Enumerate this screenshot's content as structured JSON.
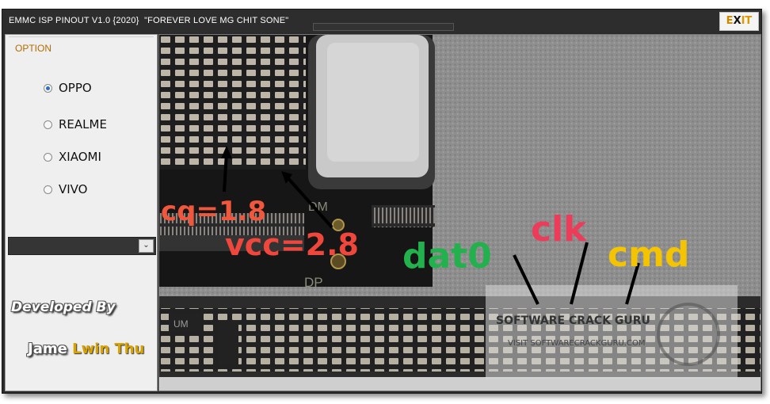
{
  "window": {
    "title": "EMMC ISP PINOUT V1.0 {2020}  \"FOREVER LOVE MG CHIT SONE\"",
    "exit_label": {
      "part1": "E",
      "part2": "X",
      "part3": "IT"
    }
  },
  "options": {
    "group_label": "OPTION",
    "items": [
      {
        "label": "OPPO",
        "selected": true
      },
      {
        "label": "REALME",
        "selected": false
      },
      {
        "label": "XIAOMI",
        "selected": false
      },
      {
        "label": "VIVO",
        "selected": false
      }
    ],
    "dropdown_value": ""
  },
  "credits": {
    "developed_by": "Developed By",
    "name_first": "Jame",
    "name_last": "Lwin Thu"
  },
  "pinout_image": {
    "labels": {
      "vccq": "cq=1.8",
      "vcc": "vcc=2.8",
      "dat0": "dat0",
      "clk": "clk",
      "cmd": "cmd",
      "dm": "DM",
      "dp": "DP",
      "um": "UM"
    },
    "watermark": {
      "title": "SOFTWARE CRACK GURU",
      "url": "VISIT SOFTWARECRACKGURU.COM"
    },
    "colors": {
      "vccq": "#f0573d",
      "vcc": "#f0473d",
      "dat0": "#22b14c",
      "clk": "#ec3c5a",
      "cmd": "#f5c400"
    }
  }
}
